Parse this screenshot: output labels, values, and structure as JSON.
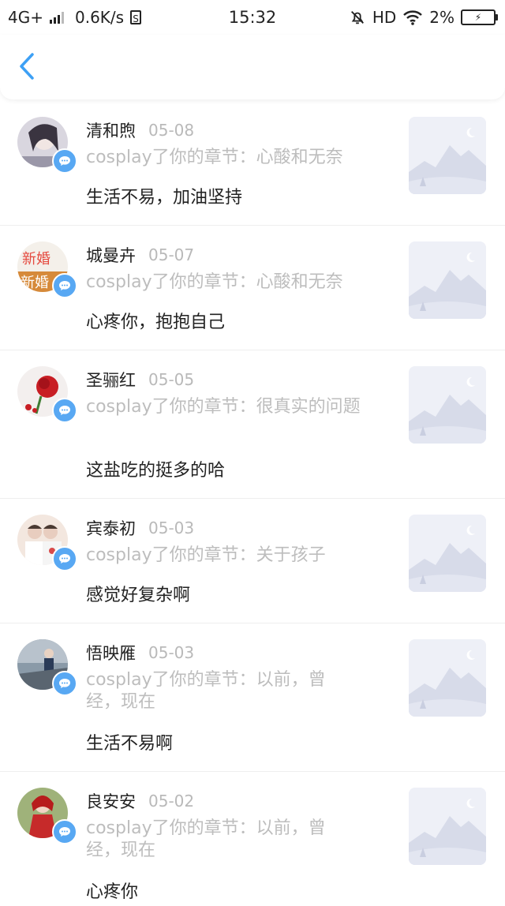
{
  "status_bar": {
    "network": "4G+",
    "speed": "0.6K/s",
    "time": "15:32",
    "hd": "HD",
    "battery": "2%"
  },
  "header": {
    "back_icon": "chevron-left-icon"
  },
  "items": [
    {
      "name": "清和煦",
      "date": "05-08",
      "subtitle": "cosplay了你的章节：心酸和无奈",
      "message": "生活不易，加油坚持",
      "avatar_color": "#d9d6df"
    },
    {
      "name": "城曼卉",
      "date": "05-07",
      "subtitle": "cosplay了你的章节：心酸和无奈",
      "message": "心疼你，抱抱自己",
      "avatar_color": "#e54a3f"
    },
    {
      "name": "圣骊红",
      "date": "05-05",
      "subtitle": "cosplay了你的章节：很真实的问题",
      "message": "这盐吃的挺多的哈",
      "avatar_color": "#c81e24"
    },
    {
      "name": "宾泰初",
      "date": "05-03",
      "subtitle": "cosplay了你的章节：关于孩子",
      "message": "感觉好复杂啊",
      "avatar_color": "#e8cdbf"
    },
    {
      "name": "悟映雁",
      "date": "05-03",
      "subtitle": "cosplay了你的章节：以前，曾经，现在",
      "message": "生活不易啊",
      "avatar_color": "#8a9aa8"
    },
    {
      "name": "良安安",
      "date": "05-02",
      "subtitle": "cosplay了你的章节：以前，曾经，现在",
      "message": "心疼你",
      "avatar_color": "#c62a2a"
    }
  ],
  "colors": {
    "accent": "#3da0f5",
    "badge": "#58a8f3",
    "muted": "#bdbdbd"
  }
}
